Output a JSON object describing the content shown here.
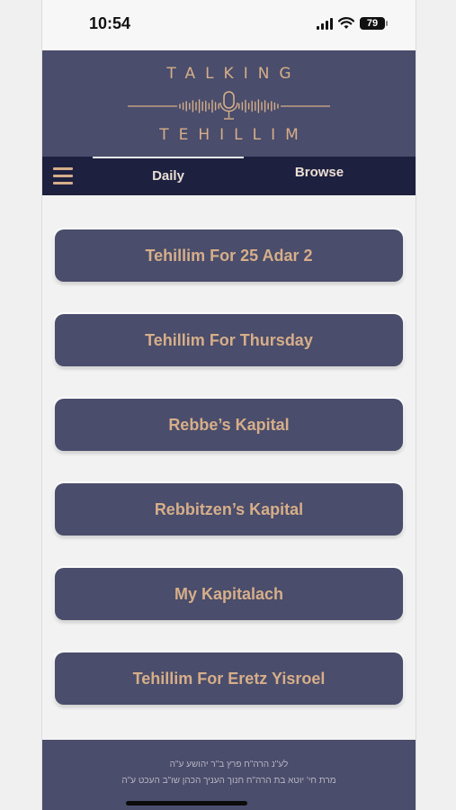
{
  "status_bar": {
    "time": "10:54",
    "battery": "79",
    "icons": [
      "signal-icon",
      "wifi-icon",
      "battery-icon"
    ]
  },
  "header": {
    "logo_top": "TALKING",
    "logo_bottom": "TEHILLIM",
    "logo_icon": "microphone-waveform-icon"
  },
  "nav": {
    "menu_icon": "hamburger-menu-icon",
    "tabs": [
      {
        "label": "Daily",
        "active": true
      },
      {
        "label": "Browse",
        "active": false
      }
    ]
  },
  "cards": [
    {
      "label": "Tehillim For 25 Adar 2"
    },
    {
      "label": "Tehillim For Thursday"
    },
    {
      "label": "Rebbe’s Kapital"
    },
    {
      "label": "Rebbitzen’s Kapital"
    },
    {
      "label": "My Kapitalach"
    },
    {
      "label": "Tehillim For Eretz Yisroel"
    }
  ],
  "footer": {
    "line1": "לע\"נ הרה\"ח פרץ ב\"ר יהושע ע\"ה",
    "line2": "מרת חי' יוטא בת הרה\"ח חנוך העניך הכהן שו\"ב העכט ע\"ה"
  },
  "colors": {
    "primary": "#4a4d6b",
    "nav": "#1e2040",
    "accent": "#d6ae8a",
    "background": "#f2f2f2"
  }
}
